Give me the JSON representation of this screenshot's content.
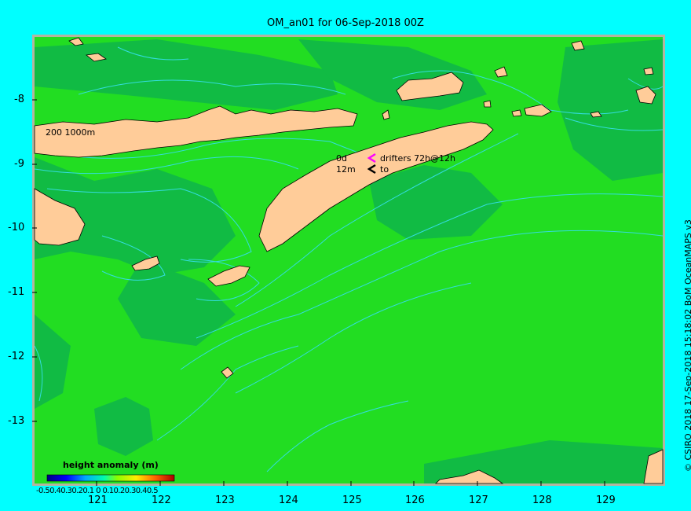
{
  "title": "OM_an01 for 06-Sep-2018 00Z",
  "y_ticks": [
    {
      "label": "-8",
      "value": -8
    },
    {
      "label": "-9",
      "value": -9
    },
    {
      "label": "-10",
      "value": -10
    },
    {
      "label": "-11",
      "value": -11
    },
    {
      "label": "-12",
      "value": -12
    },
    {
      "label": "-13",
      "value": -13
    }
  ],
  "x_ticks": [
    {
      "label": "121",
      "value": 121
    },
    {
      "label": "122",
      "value": 122
    },
    {
      "label": "123",
      "value": 123
    },
    {
      "label": "124",
      "value": 124
    },
    {
      "label": "125",
      "value": 125
    },
    {
      "label": "126",
      "value": 126
    },
    {
      "label": "127",
      "value": 127
    },
    {
      "label": "128",
      "value": 128
    },
    {
      "label": "129",
      "value": 129
    }
  ],
  "contour_label": "200  1000m",
  "legend": {
    "drifter_age": "0d",
    "drifter_text": "drifters 72h@12h",
    "depth": "12m",
    "to_text": "to"
  },
  "colorbar": {
    "title": "height anomaly  (m)",
    "labels": "-0.50.40.30.20.1 0 0.10.20.30.40.5"
  },
  "credit": "© CSIRO 2018   17-Sep-2018 15:18:02 BoM OceanMAPS v3",
  "colors": {
    "background": "#00ffff",
    "ocean_main": "#22dd22",
    "ocean_dark": "#11bb44",
    "land": "#ffcc99",
    "shelf": "#b4b4a0",
    "contour": "#33dddd",
    "drifter_magenta": "#ff00ff"
  }
}
